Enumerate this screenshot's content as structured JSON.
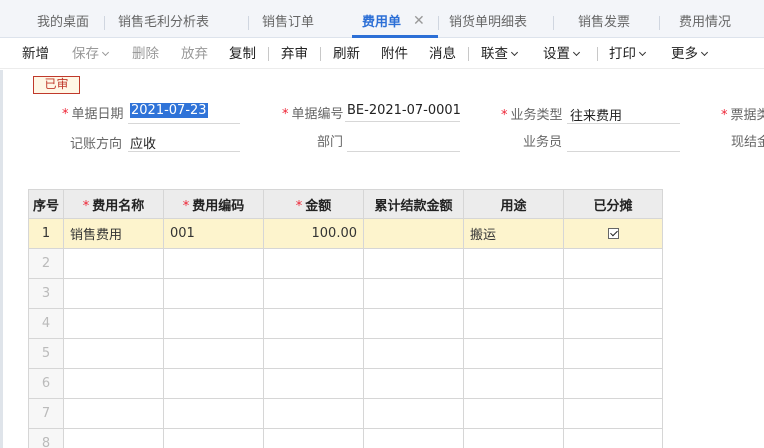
{
  "tabs": [
    {
      "label": "我的桌面"
    },
    {
      "label": "销售毛利分析表"
    },
    {
      "label": "销售订单"
    },
    {
      "label": "费用单"
    },
    {
      "label": "销货单明细表"
    },
    {
      "label": "销售发票"
    },
    {
      "label": "费用情况"
    }
  ],
  "tab_close": "✕",
  "toolbar": {
    "add": "新增",
    "save": "保存",
    "delete": "删除",
    "discard": "放弃",
    "copy": "复制",
    "unaudit": "弃审",
    "refresh": "刷新",
    "attachment": "附件",
    "message": "消息",
    "link_query": "联查",
    "settings": "设置",
    "print": "打印",
    "more": "更多"
  },
  "status_badge": "已审",
  "form": {
    "doc_date_label": "单据日期",
    "doc_date_value": "2021-07-23",
    "doc_no_label": "单据编号",
    "doc_no_value": "BE-2021-07-0001",
    "biz_type_label": "业务类型",
    "biz_type_value": "往来费用",
    "invoice_type_label": "票据类",
    "account_dir_label": "记账方向",
    "account_dir_value": "应收",
    "dept_label": "部门",
    "dept_value": "",
    "salesman_label": "业务员",
    "salesman_value": "",
    "cash_settle_label": "现结金"
  },
  "grid": {
    "headers": {
      "seq": "序号",
      "fee_name": "费用名称",
      "fee_code": "费用编码",
      "amount": "金额",
      "settled_amount": "累计结款金额",
      "usage": "用途",
      "allocated": "已分摊"
    },
    "rows": [
      {
        "seq": "1",
        "fee_name": "销售费用",
        "fee_code": "001",
        "amount": "100.00",
        "settled_amount": "",
        "usage": "搬运",
        "allocated": true
      },
      {
        "seq": "2"
      },
      {
        "seq": "3"
      },
      {
        "seq": "4"
      },
      {
        "seq": "5"
      },
      {
        "seq": "6"
      },
      {
        "seq": "7"
      },
      {
        "seq": "8"
      }
    ]
  },
  "colors": {
    "accent": "#2c6fd6",
    "badge_border": "#c0392b",
    "required": "#ee2233",
    "highlight_row": "#fdf4cd",
    "selection": "#2f73d8"
  }
}
